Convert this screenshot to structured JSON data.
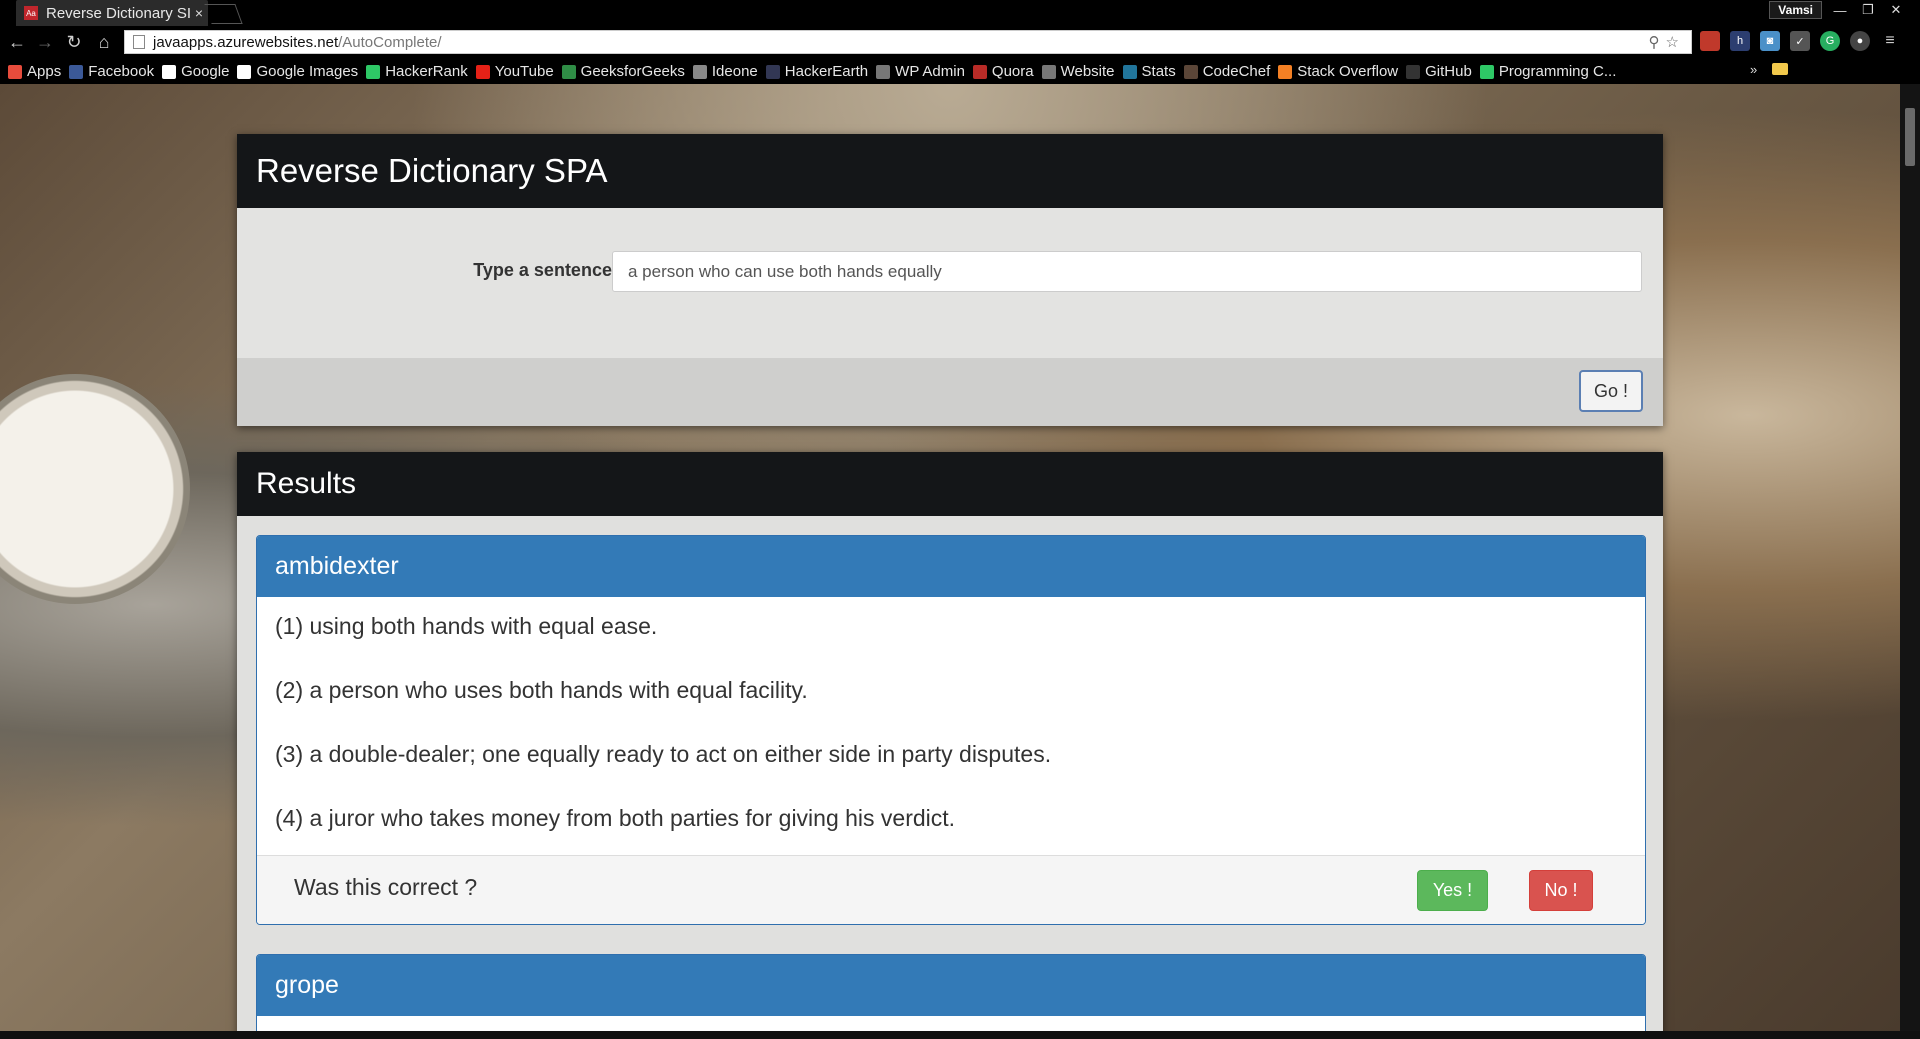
{
  "browser": {
    "tab_title": "Reverse Dictionary SI",
    "tab_close": "×",
    "user_badge": "Vamsi",
    "url_host": "javaapps.azurewebsites.net",
    "url_path": "/AutoComplete/",
    "bookmarks": [
      {
        "label": "Apps",
        "icon": "apps-grid-icon",
        "color": "#e74c3c"
      },
      {
        "label": "Facebook",
        "icon": "facebook-icon",
        "color": "#3b5998"
      },
      {
        "label": "Google",
        "icon": "google-icon",
        "color": "#ffffff"
      },
      {
        "label": "Google Images",
        "icon": "google-icon",
        "color": "#ffffff"
      },
      {
        "label": "HackerRank",
        "icon": "hackerrank-icon",
        "color": "#2ec866"
      },
      {
        "label": "YouTube",
        "icon": "youtube-icon",
        "color": "#e62117"
      },
      {
        "label": "GeeksforGeeks",
        "icon": "geeksforgeeks-icon",
        "color": "#2f8d46"
      },
      {
        "label": "Ideone",
        "icon": "ideone-icon",
        "color": "#888888"
      },
      {
        "label": "HackerEarth",
        "icon": "hackerearth-icon",
        "color": "#323754"
      },
      {
        "label": "WP Admin",
        "icon": "wordpress-icon",
        "color": "#777777"
      },
      {
        "label": "Quora",
        "icon": "quora-icon",
        "color": "#b92b27"
      },
      {
        "label": "Website",
        "icon": "website-icon",
        "color": "#777777"
      },
      {
        "label": "Stats",
        "icon": "wordpress-icon",
        "color": "#21759b"
      },
      {
        "label": "CodeChef",
        "icon": "codechef-icon",
        "color": "#5b4638"
      },
      {
        "label": "Stack Overflow",
        "icon": "stackoverflow-icon",
        "color": "#f48024"
      },
      {
        "label": "GitHub",
        "icon": "github-icon",
        "color": "#333333"
      },
      {
        "label": "Programming C...",
        "icon": "hackerrank-icon",
        "color": "#2ec866"
      }
    ],
    "bookmarks_more": "»"
  },
  "app": {
    "title": "Reverse Dictionary SPA",
    "search": {
      "label": "Type a sentence / phrase :",
      "value": "a person who can use both hands equally",
      "go_label": "Go !"
    },
    "results": {
      "title": "Results",
      "cards": [
        {
          "word": "ambidexter",
          "definitions": [
            "(1) using both hands with equal ease.",
            "(2) a person who uses both hands with equal facility.",
            "(3) a double-dealer; one equally ready to act on either side in party disputes.",
            "(4) a juror who takes money from both parties for giving his verdict."
          ],
          "question": "Was this correct ?",
          "yes_label": "Yes !",
          "no_label": "No !"
        },
        {
          "word": "grope"
        }
      ]
    }
  },
  "colors": {
    "panel_header": "#141618",
    "card_header": "#337ab7",
    "yes": "#5cb85c",
    "no": "#d9534f"
  }
}
